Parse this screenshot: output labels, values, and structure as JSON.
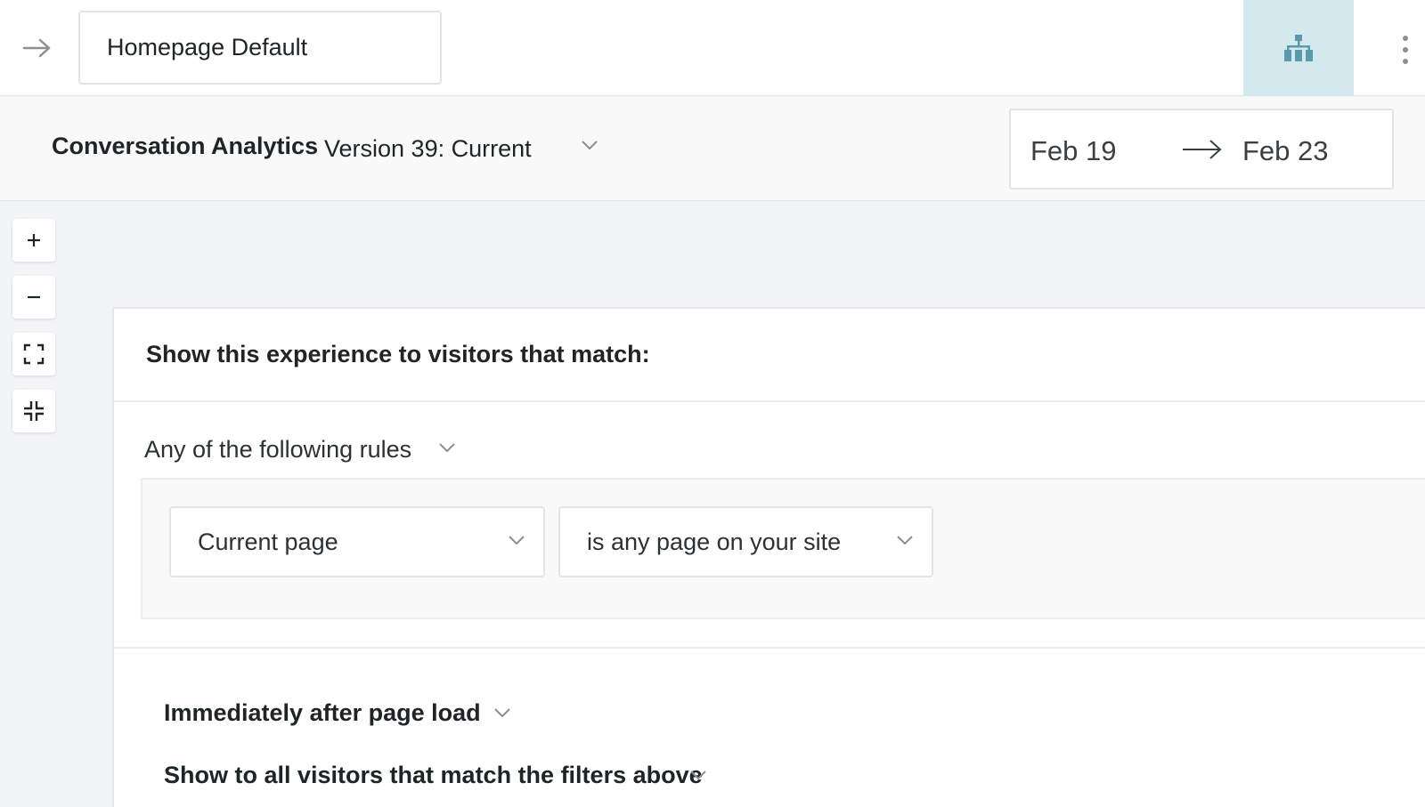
{
  "header": {
    "experience_name": "Homepage Default",
    "back_icon": "arrow-right-icon",
    "tree_icon": "sitemap-icon",
    "more_icon": "kebab-icon",
    "accent_bg": "#d3e9ee",
    "accent_icon": "#5a9aad"
  },
  "subheader": {
    "title": "Conversation Analytics",
    "version": "Version 39: Current",
    "date_start": "Feb 19",
    "date_end": "Feb 23"
  },
  "zoom": {
    "zoom_in": "+",
    "zoom_out": "−",
    "fit_icon": "expand-icon",
    "collapse_icon": "collapse-icon"
  },
  "targeting": {
    "heading": "Show this experience to visitors that match:",
    "match_mode": "Any of the following rules",
    "rule": {
      "attribute": "Current page",
      "condition": "is any page on your site"
    },
    "timing": "Immediately after page load",
    "audience": "Show to all visitors that match the filters above"
  }
}
